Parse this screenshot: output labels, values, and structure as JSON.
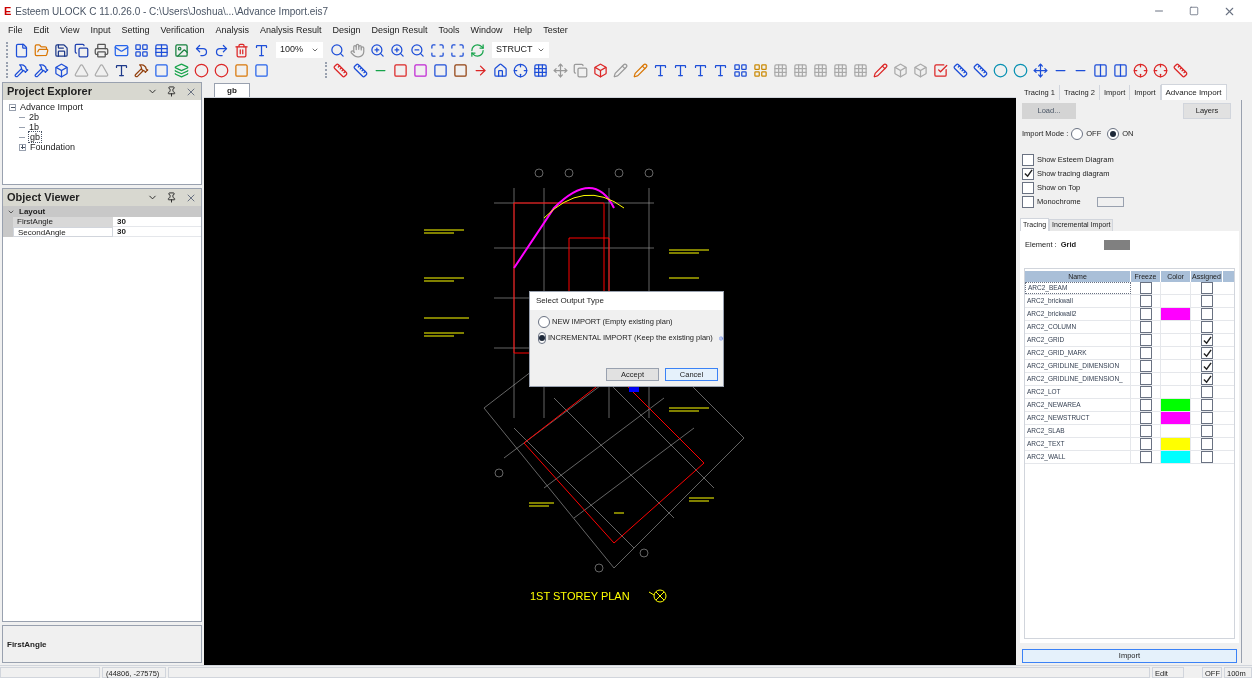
{
  "window": {
    "title": "Esteem ULOCK C 11.0.26.0 - C:\\Users\\Joshua\\...\\Advance Import.eis7",
    "logo": "E"
  },
  "menu": [
    "File",
    "Edit",
    "View",
    "Input",
    "Setting",
    "Verification",
    "Analysis",
    "Analysis Result",
    "Design",
    "Design Result",
    "Tools",
    "Window",
    "Help",
    "Tester"
  ],
  "toolbar": {
    "zoom": "100%",
    "mode": "STRUCT"
  },
  "project_explorer": {
    "title": "Project Explorer",
    "tree": [
      {
        "label": "Advance Import",
        "expanded": true,
        "selected": false,
        "children": [
          {
            "label": "2b",
            "selected": false
          },
          {
            "label": "1b",
            "selected": false
          },
          {
            "label": "gb",
            "selected": true
          },
          {
            "label": "Foundation",
            "expanded": false,
            "selected": false
          }
        ]
      }
    ]
  },
  "object_viewer": {
    "title": "Object Viewer",
    "group": "Layout",
    "properties": [
      {
        "name": "FirstAngle",
        "value": "30",
        "selected": true
      },
      {
        "name": "SecondAngle",
        "value": "30",
        "selected": false
      }
    ]
  },
  "description": {
    "title": "FirstAngle"
  },
  "document_tabs": [
    {
      "label": "gb",
      "selected": true
    }
  ],
  "canvas": {
    "plan_title": "1ST STOREY PLAN"
  },
  "dialog": {
    "title": "Select Output Type",
    "options": [
      {
        "label": "NEW IMPORT (Empty existing plan)",
        "selected": false
      },
      {
        "label": "INCREMENTAL IMPORT (Keep the existing plan)",
        "selected": true
      }
    ],
    "buttons": [
      "Accept",
      "Cancel"
    ]
  },
  "right_panel": {
    "tabs": [
      {
        "label": "Tracing 1",
        "selected": false
      },
      {
        "label": "Tracing 2",
        "selected": false
      },
      {
        "label": "Import",
        "selected": false
      },
      {
        "label": "Import",
        "selected": false
      },
      {
        "label": "Advance Import",
        "selected": true
      }
    ],
    "load_button": {
      "label": "Load...",
      "disabled": true
    },
    "layers_button": "Layers",
    "import_mode": {
      "label": "Import Mode :",
      "options": [
        {
          "label": "OFF",
          "selected": false
        },
        {
          "label": "ON",
          "selected": true
        }
      ]
    },
    "checkboxes": [
      {
        "label": "Show Esteem Diagram",
        "checked": false
      },
      {
        "label": "Show tracing diagram",
        "checked": true
      },
      {
        "label": "Show on Top",
        "checked": false
      },
      {
        "label": "Monochrome",
        "checked": false
      }
    ],
    "subtabs": [
      {
        "label": "Tracing",
        "selected": true
      },
      {
        "label": "Incremental Import",
        "selected": false
      }
    ],
    "element": {
      "label": "Element :",
      "value": "Grid",
      "color": "#808080"
    },
    "layers": {
      "columns": [
        "Name",
        "Freeze",
        "Color",
        "Assigned"
      ],
      "rows": [
        {
          "name": "ARC2_BEAM",
          "freeze": false,
          "assigned": false,
          "selected": true
        },
        {
          "name": "ARC2_brickwall",
          "freeze": false,
          "assigned": false,
          "selected": false
        },
        {
          "name": "ARC2_brickwall2",
          "freeze": false,
          "color": "#ff00ff",
          "assigned": false,
          "selected": false
        },
        {
          "name": "ARC2_COLUMN",
          "freeze": false,
          "assigned": false,
          "selected": false
        },
        {
          "name": "ARC2_GRID",
          "freeze": false,
          "assigned": true,
          "selected": false
        },
        {
          "name": "ARC2_GRID_MARK",
          "freeze": false,
          "assigned": true,
          "selected": false
        },
        {
          "name": "ARC2_GRIDLINE_DIMENSION",
          "freeze": false,
          "assigned": true,
          "selected": false
        },
        {
          "name": "ARC2_GRIDLINE_DIMENSION_",
          "freeze": false,
          "assigned": true,
          "selected": false
        },
        {
          "name": "ARC2_LOT",
          "freeze": false,
          "assigned": false,
          "selected": false
        },
        {
          "name": "ARC2_NEWAREA",
          "freeze": false,
          "color": "#00ff00",
          "assigned": false,
          "selected": false
        },
        {
          "name": "ARC2_NEWSTRUCT",
          "freeze": false,
          "color": "#ff00ff",
          "assigned": false,
          "selected": false
        },
        {
          "name": "ARC2_SLAB",
          "freeze": false,
          "assigned": false,
          "selected": false
        },
        {
          "name": "ARC2_TEXT",
          "freeze": false,
          "color": "#ffff00",
          "assigned": false,
          "selected": false
        },
        {
          "name": "ARC2_WALL",
          "freeze": false,
          "color": "#00ffff",
          "assigned": false,
          "selected": false
        }
      ]
    },
    "import_button": "Import"
  },
  "status_bar": {
    "coordinates": "(44806, -27575)",
    "mode": "Edit",
    "snap": "OFF",
    "unit": "100m"
  }
}
